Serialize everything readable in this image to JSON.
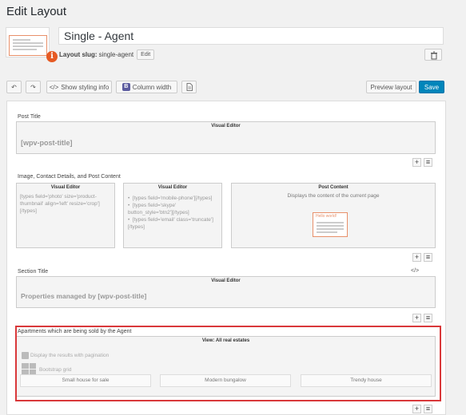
{
  "page": {
    "title": "Edit Layout"
  },
  "layout": {
    "name": "Single - Agent",
    "slug_label": "Layout slug:",
    "slug": "single-agent",
    "edit_label": "Edit",
    "info_badge": "i"
  },
  "toolbar": {
    "undo_glyph": "↶",
    "redo_glyph": "↷",
    "styling_label": "Show styling info",
    "styling_glyph": "</>",
    "column_width_label": "Column width",
    "b_glyph": "B",
    "preview_label": "Preview layout",
    "save_label": "Save"
  },
  "rows": [
    {
      "label": "Post Title",
      "cells": [
        {
          "title": "Visual Editor",
          "content": "[wpv-post-title]"
        }
      ]
    },
    {
      "label": "Image, Contact Details, and Post Content",
      "cells": [
        {
          "title": "Visual Editor",
          "content": "[types field='photo' size='product-thumbnail' align='left' resize='crop'][/types]"
        },
        {
          "title": "Visual Editor",
          "items": [
            "[types field='mobile-phone'][/types]",
            "[types field='skype' button_style='btn2'][/types]",
            "[types field='email' class='truncate'][/types]"
          ]
        },
        {
          "title": "Post Content",
          "subtitle": "Displays the content of the current page",
          "hello": "Hello world!"
        }
      ]
    },
    {
      "label": "Section Title",
      "code_glyph": "</>",
      "cells": [
        {
          "title": "Visual Editor",
          "content": "Properties managed by [wpv-post-title]"
        }
      ]
    },
    {
      "label": "Apartments which are being sold by the Agent",
      "cells": [
        {
          "title": "View: All real estates",
          "pagination": "Display the results with pagination",
          "grid": "Bootstrap grid",
          "items": [
            "Small house for sale",
            "Modern bungalow",
            "Trendy house"
          ]
        }
      ]
    }
  ],
  "controls": {
    "plus": "+",
    "menu": "≡"
  }
}
